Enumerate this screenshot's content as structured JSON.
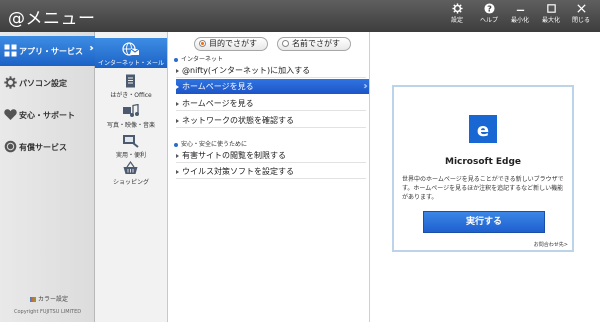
{
  "titlebar": {
    "title": "@メニュー",
    "buttons": [
      {
        "label": "設定",
        "icon": "gear-icon"
      },
      {
        "label": "ヘルプ",
        "icon": "help-icon"
      },
      {
        "label": "最小化",
        "icon": "minimize-icon"
      },
      {
        "label": "最大化",
        "icon": "maximize-icon"
      },
      {
        "label": "閉じる",
        "icon": "close-icon"
      }
    ]
  },
  "leftnav": {
    "items": [
      {
        "label": "アプリ・サービス",
        "icon": "apps-grid-icon"
      },
      {
        "label": "パソコン設定",
        "icon": "gear-icon"
      },
      {
        "label": "安心・サポート",
        "icon": "heart-icon"
      },
      {
        "label": "有償サービス",
        "icon": "paid-service-icon"
      }
    ],
    "color_setting": "カラー設定",
    "copyright": "Copyright FUJITSU LIMITED"
  },
  "categories": [
    {
      "label": "インターネット・メール",
      "icon": "globe-mail-icon"
    },
    {
      "label": "はがき・Office",
      "icon": "document-icon"
    },
    {
      "label": "写真・映像・音楽",
      "icon": "music-note-icon"
    },
    {
      "label": "実用・便利",
      "icon": "tools-icon"
    },
    {
      "label": "ショッピング",
      "icon": "shopping-basket-icon"
    }
  ],
  "search_mode": {
    "purpose": "目的でさがす",
    "name": "名前でさがす"
  },
  "sections": [
    {
      "header": "インターネット",
      "items": [
        "@nifty(インターネット)に加入する",
        "ホームページを見る",
        "ホームページを見る",
        "ネットワークの状態を確認する"
      ]
    },
    {
      "header": "安心・安全に使うために",
      "items": [
        "有害サイトの閲覧を制限する",
        "ウイルス対策ソフトを設定する"
      ]
    }
  ],
  "detail": {
    "app_name": "Microsoft Edge",
    "description": "世界中のホームページを見ることができる新しいブラウザです。ホームページを見るほか注釈を追記するなど新しい機能があります。",
    "run_label": "実行する",
    "inquiry": "お問合わせ先>",
    "brand_color": "#1967d2"
  },
  "colors": {
    "accent": "#1c62c6",
    "titlebar": "#4a4a4a",
    "radio_on": "#f06c13"
  }
}
